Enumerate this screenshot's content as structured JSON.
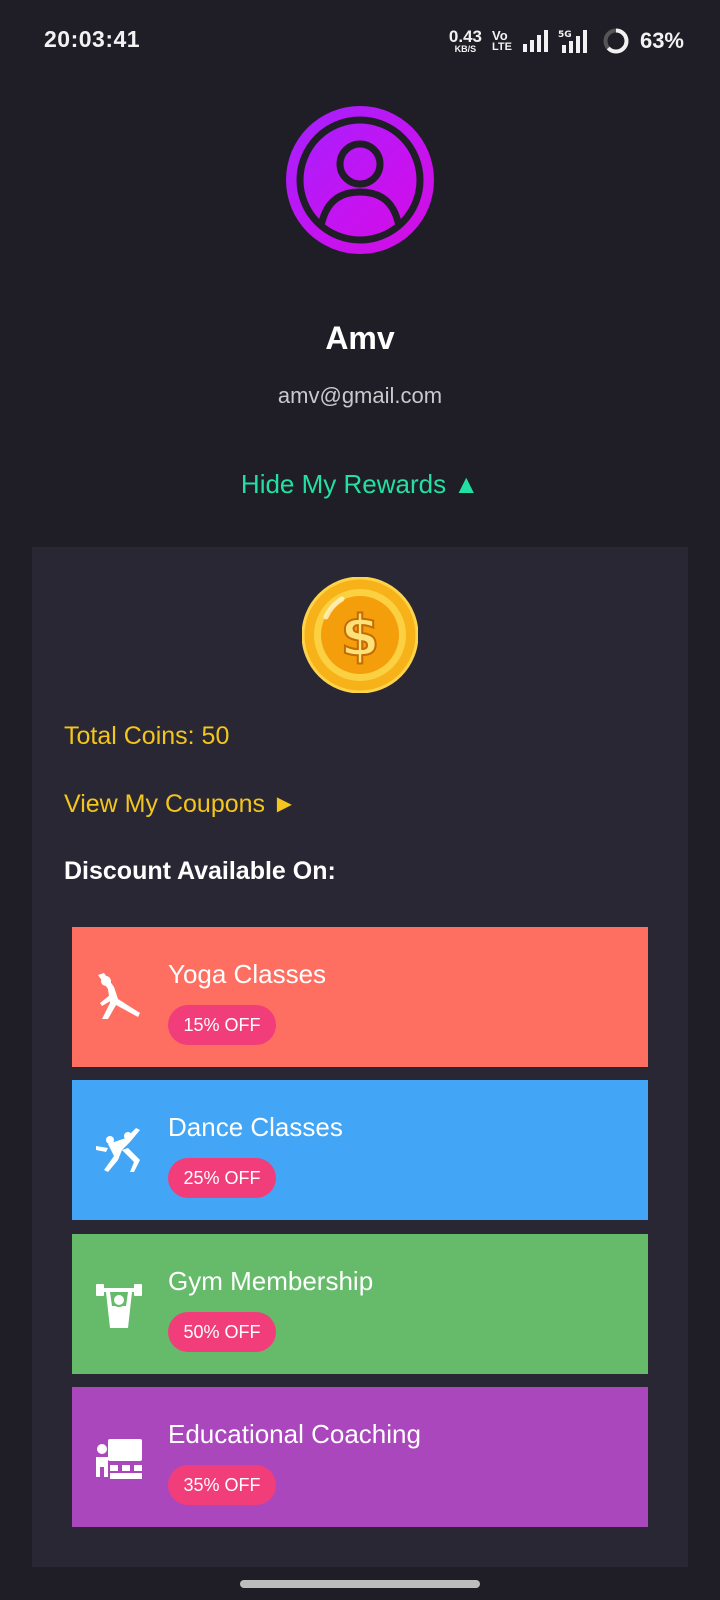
{
  "status_bar": {
    "time": "20:03:41",
    "net_speed_value": "0.43",
    "net_speed_unit": "KB/S",
    "volte_top": "Vo",
    "volte_bottom": "LTE",
    "battery_percent": "63%"
  },
  "profile": {
    "avatar_icon": "user-circle-icon",
    "name": "Amv",
    "email": "amv@gmail.com"
  },
  "rewards_toggle": {
    "label": "Hide My Rewards ▲",
    "color": "#23e0a2"
  },
  "rewards": {
    "coin_icon": "dollar-coin-icon",
    "total_coins": "Total Coins: 50",
    "view_coupons": "View My Coupons ►",
    "discount_heading": "Discount Available On:",
    "offers": [
      {
        "title": "Yoga Classes",
        "discount": "15% OFF",
        "icon": "yoga-pose-icon",
        "color": "#ff6f61"
      },
      {
        "title": "Dance Classes",
        "discount": "25% OFF",
        "icon": "dancing-couple-icon",
        "color": "#42a5f5"
      },
      {
        "title": "Gym Membership",
        "discount": "50% OFF",
        "icon": "weightlifter-icon",
        "color": "#66bb6a"
      },
      {
        "title": "Educational Coaching",
        "discount": "35% OFF",
        "icon": "classroom-icon",
        "color": "#ab47bc"
      }
    ]
  },
  "colors": {
    "background": "#1f1d25",
    "card": "#282733",
    "accent_yellow": "#f4c51c",
    "badge": "#f23d7b",
    "avatar_gradient": "#a322ff"
  }
}
